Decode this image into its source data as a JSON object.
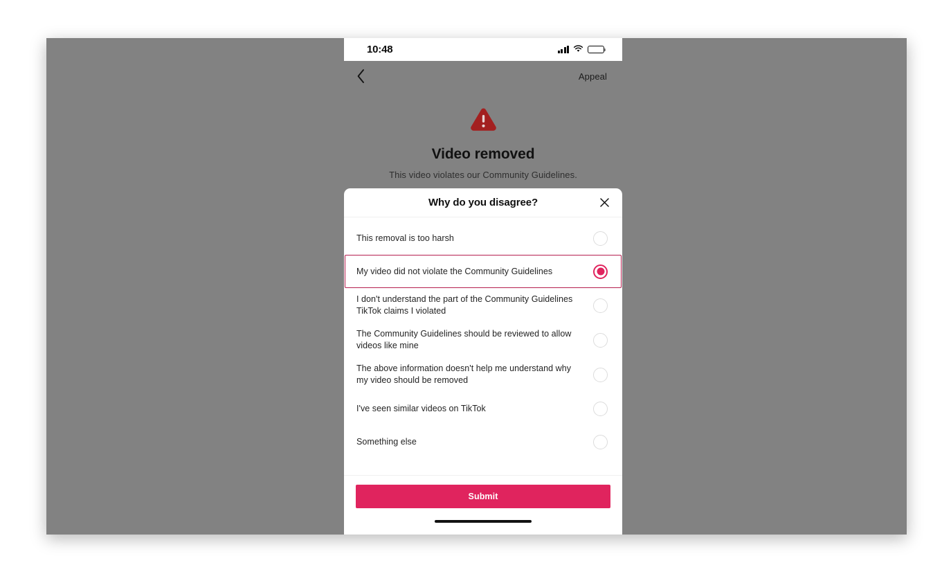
{
  "status_bar": {
    "time": "10:48",
    "cellular_icon": "cellular-signal-icon",
    "wifi_icon": "wifi-icon",
    "battery_icon": "battery-full-icon"
  },
  "navbar": {
    "back_icon": "back-chevron-icon",
    "appeal_label": "Appeal"
  },
  "notice": {
    "warning_icon": "warning-triangle-icon",
    "title": "Video removed",
    "subtitle": "This video violates our Community Guidelines."
  },
  "sheet": {
    "title": "Why do you disagree?",
    "close_icon": "close-x-icon",
    "options": [
      {
        "label": "This removal is too harsh",
        "selected": false
      },
      {
        "label": "My video did not violate the Community Guidelines",
        "selected": true
      },
      {
        "label": "I don't understand the part of the Community Guidelines TikTok claims I violated",
        "selected": false
      },
      {
        "label": "The Community Guidelines should be reviewed to allow videos like mine",
        "selected": false
      },
      {
        "label": "The above information doesn't help me understand why my video should be removed",
        "selected": false
      },
      {
        "label": "I've seen similar videos on TikTok",
        "selected": false
      },
      {
        "label": "Something else",
        "selected": false
      }
    ],
    "submit_label": "Submit"
  },
  "colors": {
    "accent": "#e0245e",
    "selected_border": "#b51e4e",
    "warning_red": "#a32020",
    "backdrop_gray": "#828282"
  }
}
